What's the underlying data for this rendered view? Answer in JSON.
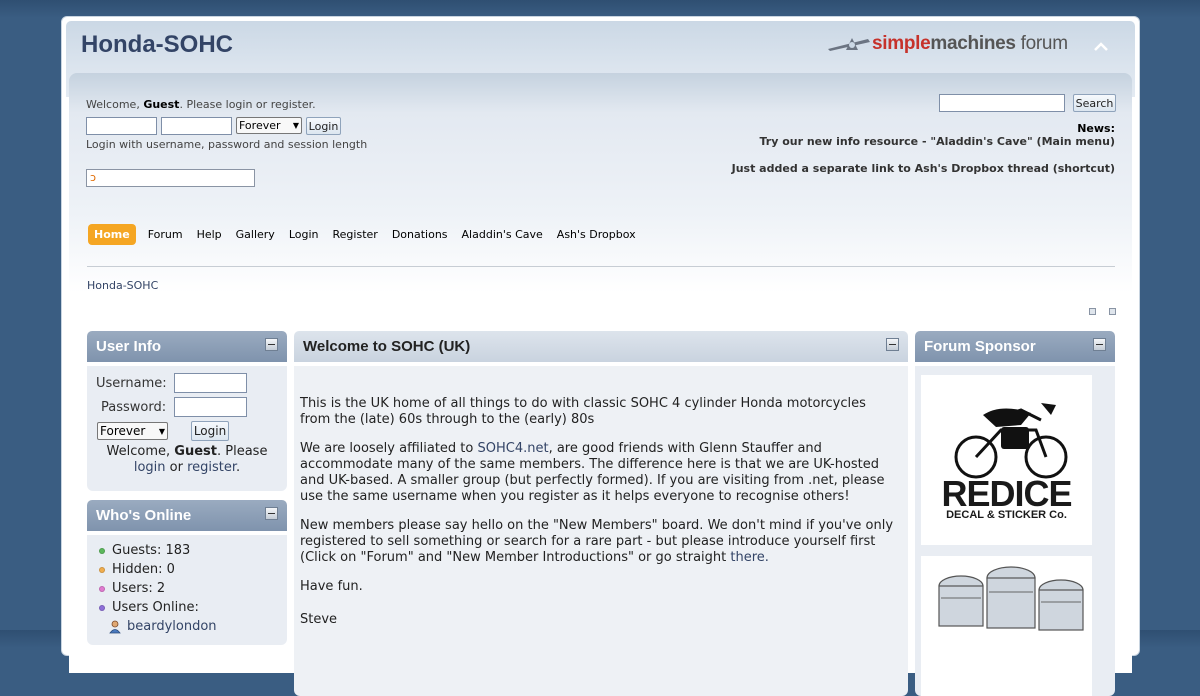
{
  "header": {
    "forum_title": "Honda-SOHC",
    "logo": {
      "part1": "simple",
      "part2": "machines",
      "part3": " forum"
    },
    "upshrink_icon": "chevron-up-icon"
  },
  "login_bar": {
    "welcome_prefix": "Welcome, ",
    "welcome_guest": "Guest",
    "welcome_middle": ". Please ",
    "login_link": "login",
    "or_text": " or ",
    "register_link": "register",
    "period": ".",
    "session_length": "Forever",
    "login_button": "Login",
    "hint": "Login with username, password and session length"
  },
  "search": {
    "button": "Search"
  },
  "news": {
    "label": "News:",
    "items": [
      "Try our new info resource - \"Aladdin's Cave\" (Main menu)",
      "Just added a separate link to Ash's Dropbox thread (shortcut)"
    ]
  },
  "menu": {
    "items": [
      "Home",
      "Forum",
      "Help",
      "Gallery",
      "Login",
      "Register",
      "Donations",
      "Aladdin's Cave",
      "Ash's Dropbox"
    ]
  },
  "breadcrumb": "Honda-SOHC",
  "user_info": {
    "title": "User Info",
    "username_label": "Username:",
    "password_label": "Password:",
    "session_length": "Forever",
    "login_button": "Login",
    "welcome_prefix": "Welcome, ",
    "welcome_guest": "Guest",
    "welcome_suffix": ". Please",
    "login_link": "login",
    "or_text": " or ",
    "register_link": "register",
    "period": "."
  },
  "whos_online": {
    "title": "Who's Online",
    "guests": "Guests: 183",
    "hidden": "Hidden: 0",
    "users": "Users: 2",
    "users_online": "Users Online:",
    "first_user": "beardylondon",
    "dot_colors": [
      "#5cb85c",
      "#f0ad4e",
      "#d9534f",
      "#8e6fd8"
    ]
  },
  "welcome_box": {
    "title": "Welcome to SOHC (UK)",
    "p1": "This is the UK home of all things to do with classic SOHC 4 cylinder Honda motorcycles from the (late) 60s through to the (early) 80s",
    "p2_a": "We are loosely affiliated to ",
    "p2_link": "SOHC4.net",
    "p2_b": ", are good friends with Glenn Stauffer and accommodate many of the same members. The difference here is that we are UK-hosted and UK-based. A smaller group (but perfectly formed). If you are visiting from .net, please use the same username when you register as it helps everyone to recognise others!",
    "p3_a": "New members please say hello on the \"New Members\" board. We don't mind if you've only registered to sell something or search for a rare part - but please introduce yourself first (Click on \"Forum\" and \"New Member Introductions\" or go straight ",
    "p3_link": "there.",
    "p4": "Have fun.",
    "p5": "Steve"
  },
  "forum_sponsor": {
    "title": "Forum Sponsor",
    "logo_word": "REDICE",
    "logo_sub": "DECAL & STICKER Co."
  },
  "colors": {
    "title": "#334466",
    "menu_active": "#f5a623",
    "cathead": "#8a9db6",
    "link": "#334466"
  }
}
